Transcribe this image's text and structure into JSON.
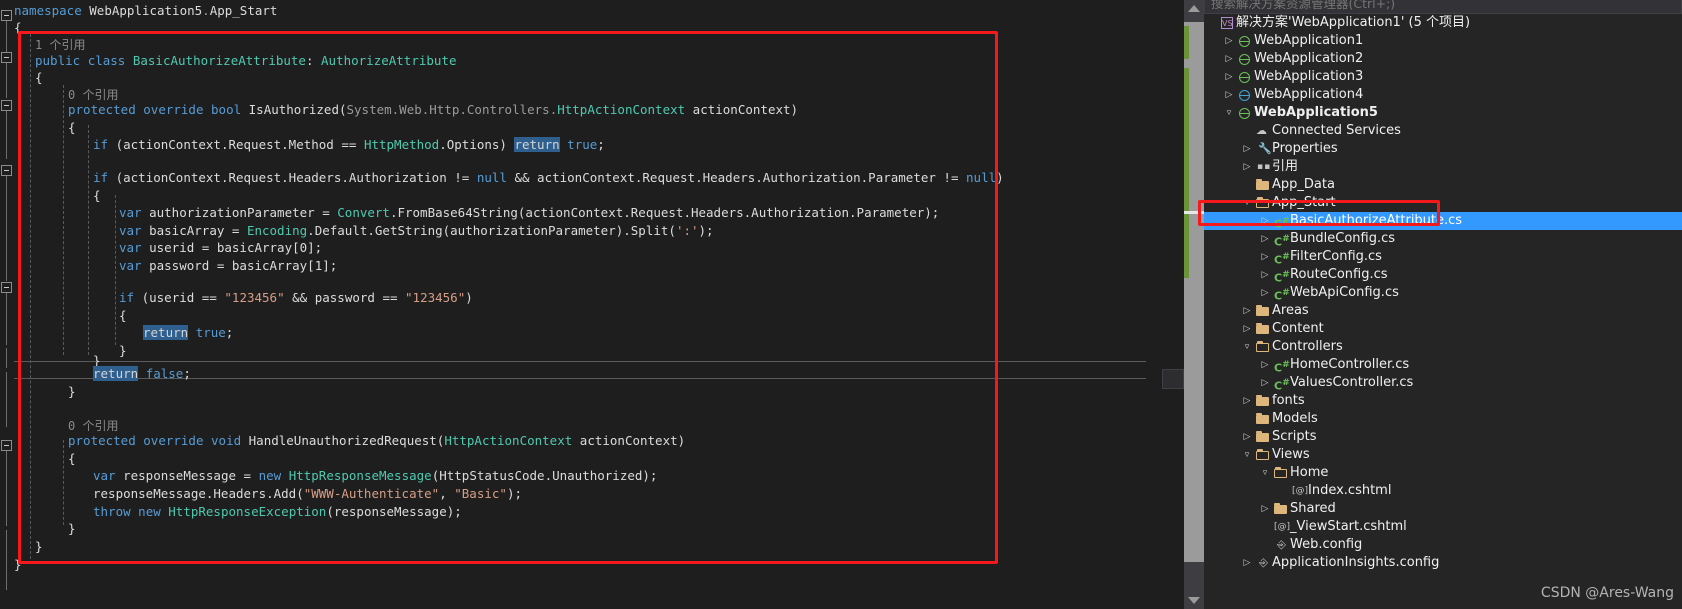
{
  "editor": {
    "namespace_line": "namespace WebApplication5.App_Start",
    "current_line_text": "return false;",
    "annotation_boxes": 1,
    "codelens": {
      "class_refs": "1 个引用",
      "method1_refs": "0 个引用",
      "method2_refs": "0 个引用"
    },
    "code_lines": [
      "namespace WebApplication5.App_Start",
      "{",
      "    1 个引用",
      "    public class BasicAuthorizeAttribute: AuthorizeAttribute",
      "    {",
      "        0 个引用",
      "        protected override bool IsAuthorized(System.Web.Http.Controllers.HttpActionContext actionContext)",
      "        {",
      "            if (actionContext.Request.Method == HttpMethod.Options) return true;",
      "",
      "            if (actionContext.Request.Headers.Authorization != null && actionContext.Request.Headers.Authorization.Parameter != null)",
      "            {",
      "                var authorizationParameter = Convert.FromBase64String(actionContext.Request.Headers.Authorization.Parameter);",
      "                var basicArray = Encoding.Default.GetString(authorizationParameter).Split(':');",
      "                var userid = basicArray[0];",
      "                var password = basicArray[1];",
      "",
      "                if (userid == \"123456\" && password == \"123456\")",
      "                {",
      "                    return true;",
      "                }",
      "            }",
      "            return false;",
      "        }",
      "",
      "        0 个引用",
      "        protected override void HandleUnauthorizedRequest(HttpActionContext actionContext)",
      "        {",
      "            var responseMessage = new HttpResponseMessage(HttpStatusCode.Unauthorized);",
      "            responseMessage.Headers.Add(\"WWW-Authenticate\", \"Basic\");",
      "            throw new HttpResponseException(responseMessage);",
      "        }",
      "    }",
      "}"
    ],
    "selected_token": "return",
    "string_literals": [
      "123456",
      "123456",
      "WWW-Authenticate",
      "Basic",
      "':'"
    ]
  },
  "solution_explorer": {
    "search_placeholder": "搜索解决方案资源管理器(Ctrl+;)",
    "tree": [
      {
        "label": "解决方案'WebApplication1' (5 个项目)",
        "icon": "solution-icon",
        "indent": 0,
        "twisty": "",
        "bold": false
      },
      {
        "label": "WebApplication1",
        "icon": "web-project-icon",
        "indent": 1,
        "twisty": "collapsed",
        "bold": false
      },
      {
        "label": "WebApplication2",
        "icon": "web-project-icon",
        "indent": 1,
        "twisty": "collapsed",
        "bold": false
      },
      {
        "label": "WebApplication3",
        "icon": "web-project-icon",
        "indent": 1,
        "twisty": "collapsed",
        "bold": false
      },
      {
        "label": "WebApplication4",
        "icon": "web-project-blue-icon",
        "indent": 1,
        "twisty": "collapsed",
        "bold": false
      },
      {
        "label": "WebApplication5",
        "icon": "web-project-icon",
        "indent": 1,
        "twisty": "expanded",
        "bold": true
      },
      {
        "label": "Connected Services",
        "icon": "cloud-icon",
        "indent": 2,
        "twisty": "",
        "bold": false
      },
      {
        "label": "Properties",
        "icon": "wrench-icon",
        "indent": 2,
        "twisty": "collapsed",
        "bold": false
      },
      {
        "label": "引用",
        "icon": "references-icon",
        "indent": 2,
        "twisty": "collapsed",
        "bold": false
      },
      {
        "label": "App_Data",
        "icon": "folder-icon",
        "indent": 2,
        "twisty": "",
        "bold": false
      },
      {
        "label": "App_Start",
        "icon": "folder-open-icon",
        "indent": 2,
        "twisty": "expanded",
        "bold": false
      },
      {
        "label": "BasicAuthorizeAttribute.cs",
        "icon": "csharp-file-icon",
        "indent": 3,
        "twisty": "collapsed",
        "bold": false,
        "selected": true
      },
      {
        "label": "BundleConfig.cs",
        "icon": "csharp-file-icon",
        "indent": 3,
        "twisty": "collapsed",
        "bold": false
      },
      {
        "label": "FilterConfig.cs",
        "icon": "csharp-file-icon",
        "indent": 3,
        "twisty": "collapsed",
        "bold": false
      },
      {
        "label": "RouteConfig.cs",
        "icon": "csharp-file-icon",
        "indent": 3,
        "twisty": "collapsed",
        "bold": false
      },
      {
        "label": "WebApiConfig.cs",
        "icon": "csharp-file-icon",
        "indent": 3,
        "twisty": "collapsed",
        "bold": false
      },
      {
        "label": "Areas",
        "icon": "folder-icon",
        "indent": 2,
        "twisty": "collapsed",
        "bold": false
      },
      {
        "label": "Content",
        "icon": "folder-icon",
        "indent": 2,
        "twisty": "collapsed",
        "bold": false
      },
      {
        "label": "Controllers",
        "icon": "folder-open-icon",
        "indent": 2,
        "twisty": "expanded",
        "bold": false
      },
      {
        "label": "HomeController.cs",
        "icon": "csharp-file-icon",
        "indent": 3,
        "twisty": "collapsed",
        "bold": false
      },
      {
        "label": "ValuesController.cs",
        "icon": "csharp-file-icon",
        "indent": 3,
        "twisty": "collapsed",
        "bold": false
      },
      {
        "label": "fonts",
        "icon": "folder-icon",
        "indent": 2,
        "twisty": "collapsed",
        "bold": false
      },
      {
        "label": "Models",
        "icon": "folder-icon",
        "indent": 2,
        "twisty": "",
        "bold": false
      },
      {
        "label": "Scripts",
        "icon": "folder-icon",
        "indent": 2,
        "twisty": "collapsed",
        "bold": false
      },
      {
        "label": "Views",
        "icon": "folder-open-icon",
        "indent": 2,
        "twisty": "expanded",
        "bold": false
      },
      {
        "label": "Home",
        "icon": "folder-open-icon",
        "indent": 3,
        "twisty": "expanded",
        "bold": false
      },
      {
        "label": "Index.cshtml",
        "icon": "razor-file-icon",
        "indent": 4,
        "twisty": "",
        "bold": false
      },
      {
        "label": "Shared",
        "icon": "folder-icon",
        "indent": 3,
        "twisty": "collapsed",
        "bold": false
      },
      {
        "label": "_ViewStart.cshtml",
        "icon": "razor-file-icon",
        "indent": 3,
        "twisty": "",
        "bold": false
      },
      {
        "label": "Web.config",
        "icon": "config-file-icon",
        "indent": 3,
        "twisty": "",
        "bold": false
      },
      {
        "label": "ApplicationInsights.config",
        "icon": "config-file-icon",
        "indent": 2,
        "twisty": "collapsed",
        "bold": false
      }
    ]
  },
  "watermark": {
    "text": "CSDN @Ares-Wang"
  },
  "colors": {
    "editor_bg": "#1e1e1e",
    "panel_bg": "#252526",
    "selection_blue": "#3399ff",
    "annotation_red": "#f5191b",
    "keyword_blue": "#569cd6",
    "type_teal": "#4ec9b0",
    "string_orange": "#d69d85",
    "changebar_green": "#6a9437"
  }
}
